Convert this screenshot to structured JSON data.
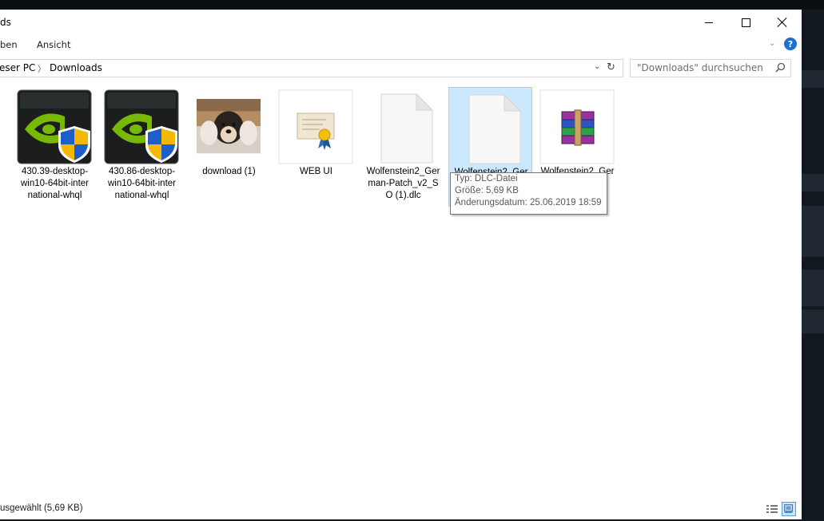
{
  "window": {
    "title_fragment": "ds"
  },
  "ribbon": {
    "tabs": [
      {
        "label": "ben"
      },
      {
        "label": "Ansicht"
      }
    ]
  },
  "address": {
    "crumbs": [
      {
        "label": "eser PC"
      },
      {
        "label": "Downloads"
      }
    ]
  },
  "search": {
    "placeholder": "\"Downloads\" durchsuchen"
  },
  "files": [
    {
      "name": "430.39-desktop-win10-64bit-international-whql",
      "icon": "nvidia-installer-icon"
    },
    {
      "name": "430.86-desktop-win10-64bit-international-whql",
      "icon": "nvidia-installer-icon"
    },
    {
      "name": "download (1)",
      "icon": "image-thumbnail-dog"
    },
    {
      "name": "WEB UI",
      "icon": "certificate-icon"
    },
    {
      "name": "Wolfenstein2_German-Patch_v2_SO (1).dlc",
      "icon": "blank-file-icon"
    },
    {
      "name": "Wolfenstein2_German-Patch_v2_SO.dlc",
      "icon": "blank-file-icon",
      "selected": true
    },
    {
      "name": "Wolfenstein2_German-Patch_v2_SO",
      "icon": "winrar-archive-icon"
    }
  ],
  "labels": {
    "f0": "430.39-desktop-\nwin10-64bit-inter\nnational-whql",
    "f1": "430.86-desktop-\nwin10-64bit-inter\nnational-whql",
    "f2": "download (1)",
    "f3": "WEB UI",
    "f4": "Wolfenstein2_Ger\nman-Patch_v2_S\nO (1).dlc",
    "f5": "Wolfenstein2_Ger",
    "f6": "Wolfenstein2_Ger\nS"
  },
  "tooltip": {
    "type": "Typ: DLC-Datei",
    "size": "Größe: 5,69 KB",
    "modified": "Änderungsdatum: 25.06.2019 18:59"
  },
  "status": {
    "selection": "usgewählt (5,69 KB)"
  },
  "colors": {
    "selection_bg": "#cce8ff",
    "selection_border": "#99d1ff",
    "help_icon": "#1a6fd1",
    "nvidia_green": "#76b900"
  }
}
